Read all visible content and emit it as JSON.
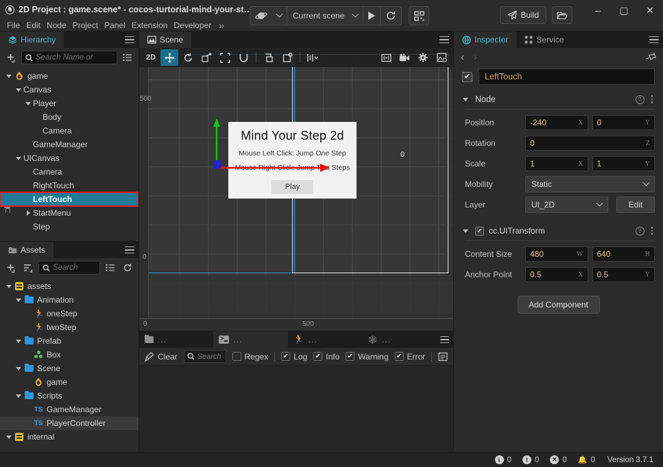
{
  "window": {
    "title": "2D Project : game.scene* - cocos-turtorial-mind-your-st…",
    "logo_icon": "cocos-logo-icon",
    "minimize_icon": "–",
    "maximize_icon": "▢",
    "close_icon": "✕"
  },
  "menubar": {
    "items": [
      "File",
      "Edit",
      "Node",
      "Project",
      "Panel",
      "Extension",
      "Developer"
    ],
    "overflow": "»"
  },
  "toolbar": {
    "platform_icon": "cocos-preview-icon",
    "scene_select": "Current scene",
    "play_icon": "play-icon",
    "refresh_icon": "↻",
    "device_icon": "qr-device-icon",
    "build_label": "Build",
    "build_icon": "paper-plane-icon",
    "folder_icon": "open-folder-icon"
  },
  "hierarchy": {
    "tab_label": "Hierarchy",
    "tab_icon": "layers-icon",
    "add_icon": "add-node-icon",
    "search_icon": "search-icon",
    "search_placeholder": "Search Name or",
    "list_icon": "list-options-icon",
    "menu_icon": "panel-menu-icon",
    "nodes": [
      {
        "label": "game",
        "depth": 0,
        "icon": "scene-flame-icon",
        "expander": "down",
        "selected": false,
        "locked": false
      },
      {
        "label": "Canvas",
        "depth": 1,
        "icon": "none",
        "expander": "down",
        "selected": false,
        "locked": false
      },
      {
        "label": "Player",
        "depth": 2,
        "icon": "none",
        "expander": "down",
        "selected": false,
        "locked": false
      },
      {
        "label": "Body",
        "depth": 3,
        "icon": "none",
        "expander": "none",
        "selected": false,
        "locked": false
      },
      {
        "label": "Camera",
        "depth": 3,
        "icon": "none",
        "expander": "none",
        "selected": false,
        "locked": false
      },
      {
        "label": "GameManager",
        "depth": 2,
        "icon": "none",
        "expander": "none",
        "selected": false,
        "locked": false
      },
      {
        "label": "UICanvas",
        "depth": 1,
        "icon": "none",
        "expander": "down",
        "selected": false,
        "locked": false
      },
      {
        "label": "Camera",
        "depth": 2,
        "icon": "none",
        "expander": "none",
        "selected": false,
        "locked": false
      },
      {
        "label": "RightTouch",
        "depth": 2,
        "icon": "none",
        "expander": "none",
        "selected": false,
        "locked": false
      },
      {
        "label": "LeftTouch",
        "depth": 2,
        "icon": "none",
        "expander": "none",
        "selected": true,
        "locked": false
      },
      {
        "label": "StartMenu",
        "depth": 2,
        "icon": "none",
        "expander": "right",
        "selected": false,
        "locked": true
      },
      {
        "label": "Step",
        "depth": 2,
        "icon": "none",
        "expander": "none",
        "selected": false,
        "locked": false
      }
    ]
  },
  "assets": {
    "tab_label": "Assets",
    "tab_icon": "assets-folder-icon",
    "add_icon": "add-asset-icon",
    "sort_icon": "sort-icon",
    "search_icon": "search-icon",
    "search_placeholder": "Search",
    "list_icon": "list-options-icon",
    "refresh_icon": "refresh-icon",
    "menu_icon": "panel-menu-icon",
    "items": [
      {
        "label": "assets",
        "depth": 0,
        "icon": "db-icon",
        "expander": "down",
        "highlight": false
      },
      {
        "label": "Animation",
        "depth": 1,
        "icon": "folder-icon",
        "expander": "down",
        "highlight": false
      },
      {
        "label": "oneStep",
        "depth": 2,
        "icon": "animation-clip-icon",
        "expander": "none",
        "highlight": false
      },
      {
        "label": "twoStep",
        "depth": 2,
        "icon": "animation-clip-icon",
        "expander": "none",
        "highlight": false
      },
      {
        "label": "Prefab",
        "depth": 1,
        "icon": "folder-icon",
        "expander": "down",
        "highlight": false
      },
      {
        "label": "Box",
        "depth": 2,
        "icon": "prefab-icon",
        "expander": "none",
        "highlight": false
      },
      {
        "label": "Scene",
        "depth": 1,
        "icon": "folder-icon",
        "expander": "down",
        "highlight": false
      },
      {
        "label": "game",
        "depth": 2,
        "icon": "scene-flame-icon",
        "expander": "none",
        "highlight": false
      },
      {
        "label": "Scripts",
        "depth": 1,
        "icon": "folder-icon",
        "expander": "down",
        "highlight": false
      },
      {
        "label": "GameManager",
        "depth": 2,
        "icon": "typescript-icon",
        "expander": "none",
        "highlight": false
      },
      {
        "label": "PlayerController",
        "depth": 2,
        "icon": "typescript-icon",
        "expander": "none",
        "highlight": true
      },
      {
        "label": "internal",
        "depth": 0,
        "icon": "db-icon",
        "expander": "down",
        "highlight": false
      }
    ]
  },
  "scene": {
    "tab_label": "Scene",
    "tab_icon": "scene-panel-icon",
    "menu_icon": "panel-menu-icon",
    "tools": [
      {
        "name": "2d-toggle",
        "glyph": "2D",
        "active": false
      },
      {
        "name": "move-tool",
        "glyph": "move-icon",
        "active": true
      },
      {
        "name": "rotate-tool",
        "glyph": "rotate-icon",
        "active": false
      },
      {
        "name": "scale-tool",
        "glyph": "scale-icon",
        "active": false
      },
      {
        "name": "rect-tool",
        "glyph": "rect-transform-icon",
        "active": false
      },
      {
        "name": "magnet-tool",
        "glyph": "magnet-icon",
        "active": false
      },
      {
        "name": "pivot-toggle",
        "glyph": "pivot-icon",
        "active": false
      },
      {
        "name": "coord-toggle",
        "glyph": "local-global-icon",
        "active": false
      },
      {
        "name": "layout-tool",
        "glyph": "align-icon",
        "active": false
      }
    ],
    "right_tools": [
      {
        "name": "grid-display-icon"
      },
      {
        "name": "camera-icon"
      },
      {
        "name": "gizmo-settings-icon"
      },
      {
        "name": "screenshot-icon"
      }
    ],
    "ruler": {
      "vertical_labels": [
        "500",
        "0"
      ],
      "horizontal_labels": [
        "0",
        "500"
      ],
      "origin_label": "0"
    },
    "game_preview": {
      "title": "Mind Your Step 2d",
      "line1": "Mouse Left Click: Jump One Step",
      "line2": "Mouse Right Click: Jump Two Steps",
      "play_label": "Play"
    },
    "gizmo": {
      "y_axis_color": "#18c218",
      "x_axis_color": "#e01010",
      "handle_color": "#2222c8"
    },
    "canvas_border_color": "#2f9fe0"
  },
  "console": {
    "tabs": [
      {
        "icon": "assets-folder-icon",
        "label": "...",
        "active": false
      },
      {
        "icon": "console-terminal-icon",
        "label": "...",
        "active": true
      },
      {
        "icon": "animation-icon",
        "label": "...",
        "active": false
      },
      {
        "icon": "animation-graph-icon",
        "label": "...",
        "active": false
      }
    ],
    "menu_icon": "panel-menu-icon",
    "clear_label": "Clear",
    "clear_icon": "broom-icon",
    "search_icon": "search-icon",
    "search_placeholder": "Search",
    "filters": [
      {
        "label": "Regex",
        "checked": false
      },
      {
        "label": "Log",
        "checked": true
      },
      {
        "label": "Info",
        "checked": true
      },
      {
        "label": "Warning",
        "checked": true
      },
      {
        "label": "Error",
        "checked": true
      }
    ],
    "collapse_icon": "collapse-lines-icon"
  },
  "inspector": {
    "tabs": [
      {
        "label": "Inspector",
        "icon": "inspector-icon",
        "active": true
      },
      {
        "label": "Service",
        "icon": "service-icon",
        "active": false
      }
    ],
    "menu_icon": "panel-menu-icon",
    "back_icon": "‹",
    "forward_icon": "›",
    "pin_icon": "pin-icon",
    "node_name": "LeftTouch",
    "node_enabled": true,
    "sections": [
      {
        "title": "Node",
        "has_checkbox": false,
        "help_icon": "help-icon",
        "menu_icon": "kebab-icon",
        "properties": [
          {
            "label": "Position",
            "type": "vec2",
            "fields": [
              {
                "value": "-240",
                "suffix": "X"
              },
              {
                "value": "0",
                "suffix": "Y"
              }
            ]
          },
          {
            "label": "Rotation",
            "type": "scalar",
            "fields": [
              {
                "value": "0",
                "suffix": "Z"
              }
            ]
          },
          {
            "label": "Scale",
            "type": "vec2",
            "fields": [
              {
                "value": "1",
                "suffix": "X"
              },
              {
                "value": "1",
                "suffix": "Y"
              }
            ]
          },
          {
            "label": "Mobility",
            "type": "select",
            "value": "Static"
          },
          {
            "label": "Layer",
            "type": "select_edit",
            "value": "UI_2D",
            "button": "Edit"
          }
        ]
      },
      {
        "title": "cc.UITransform",
        "has_checkbox": true,
        "help_icon": "help-icon",
        "menu_icon": "kebab-icon",
        "properties": [
          {
            "label": "Content Size",
            "type": "vec2",
            "fields": [
              {
                "value": "480",
                "suffix": "W"
              },
              {
                "value": "640",
                "suffix": "H"
              }
            ]
          },
          {
            "label": "Anchor Point",
            "type": "vec2",
            "fields": [
              {
                "value": "0.5",
                "suffix": "X"
              },
              {
                "value": "0.5",
                "suffix": "Y"
              }
            ]
          }
        ]
      }
    ],
    "add_component_label": "Add Component"
  },
  "statusbar": {
    "info_icon": "info-icon",
    "info_count": "0",
    "warning_icon": "warning-icon",
    "warning_count": "0",
    "error_icon": "error-icon",
    "error_count": "0",
    "bell_icon": "bell-icon",
    "bell_count": "0",
    "version": "Version 3.7.1"
  },
  "colors": {
    "accent": "#1e7a96",
    "selection_outline": "#e02020",
    "panel_bg": "#2b2b2b",
    "tab_bg": "#1d1d1d"
  }
}
